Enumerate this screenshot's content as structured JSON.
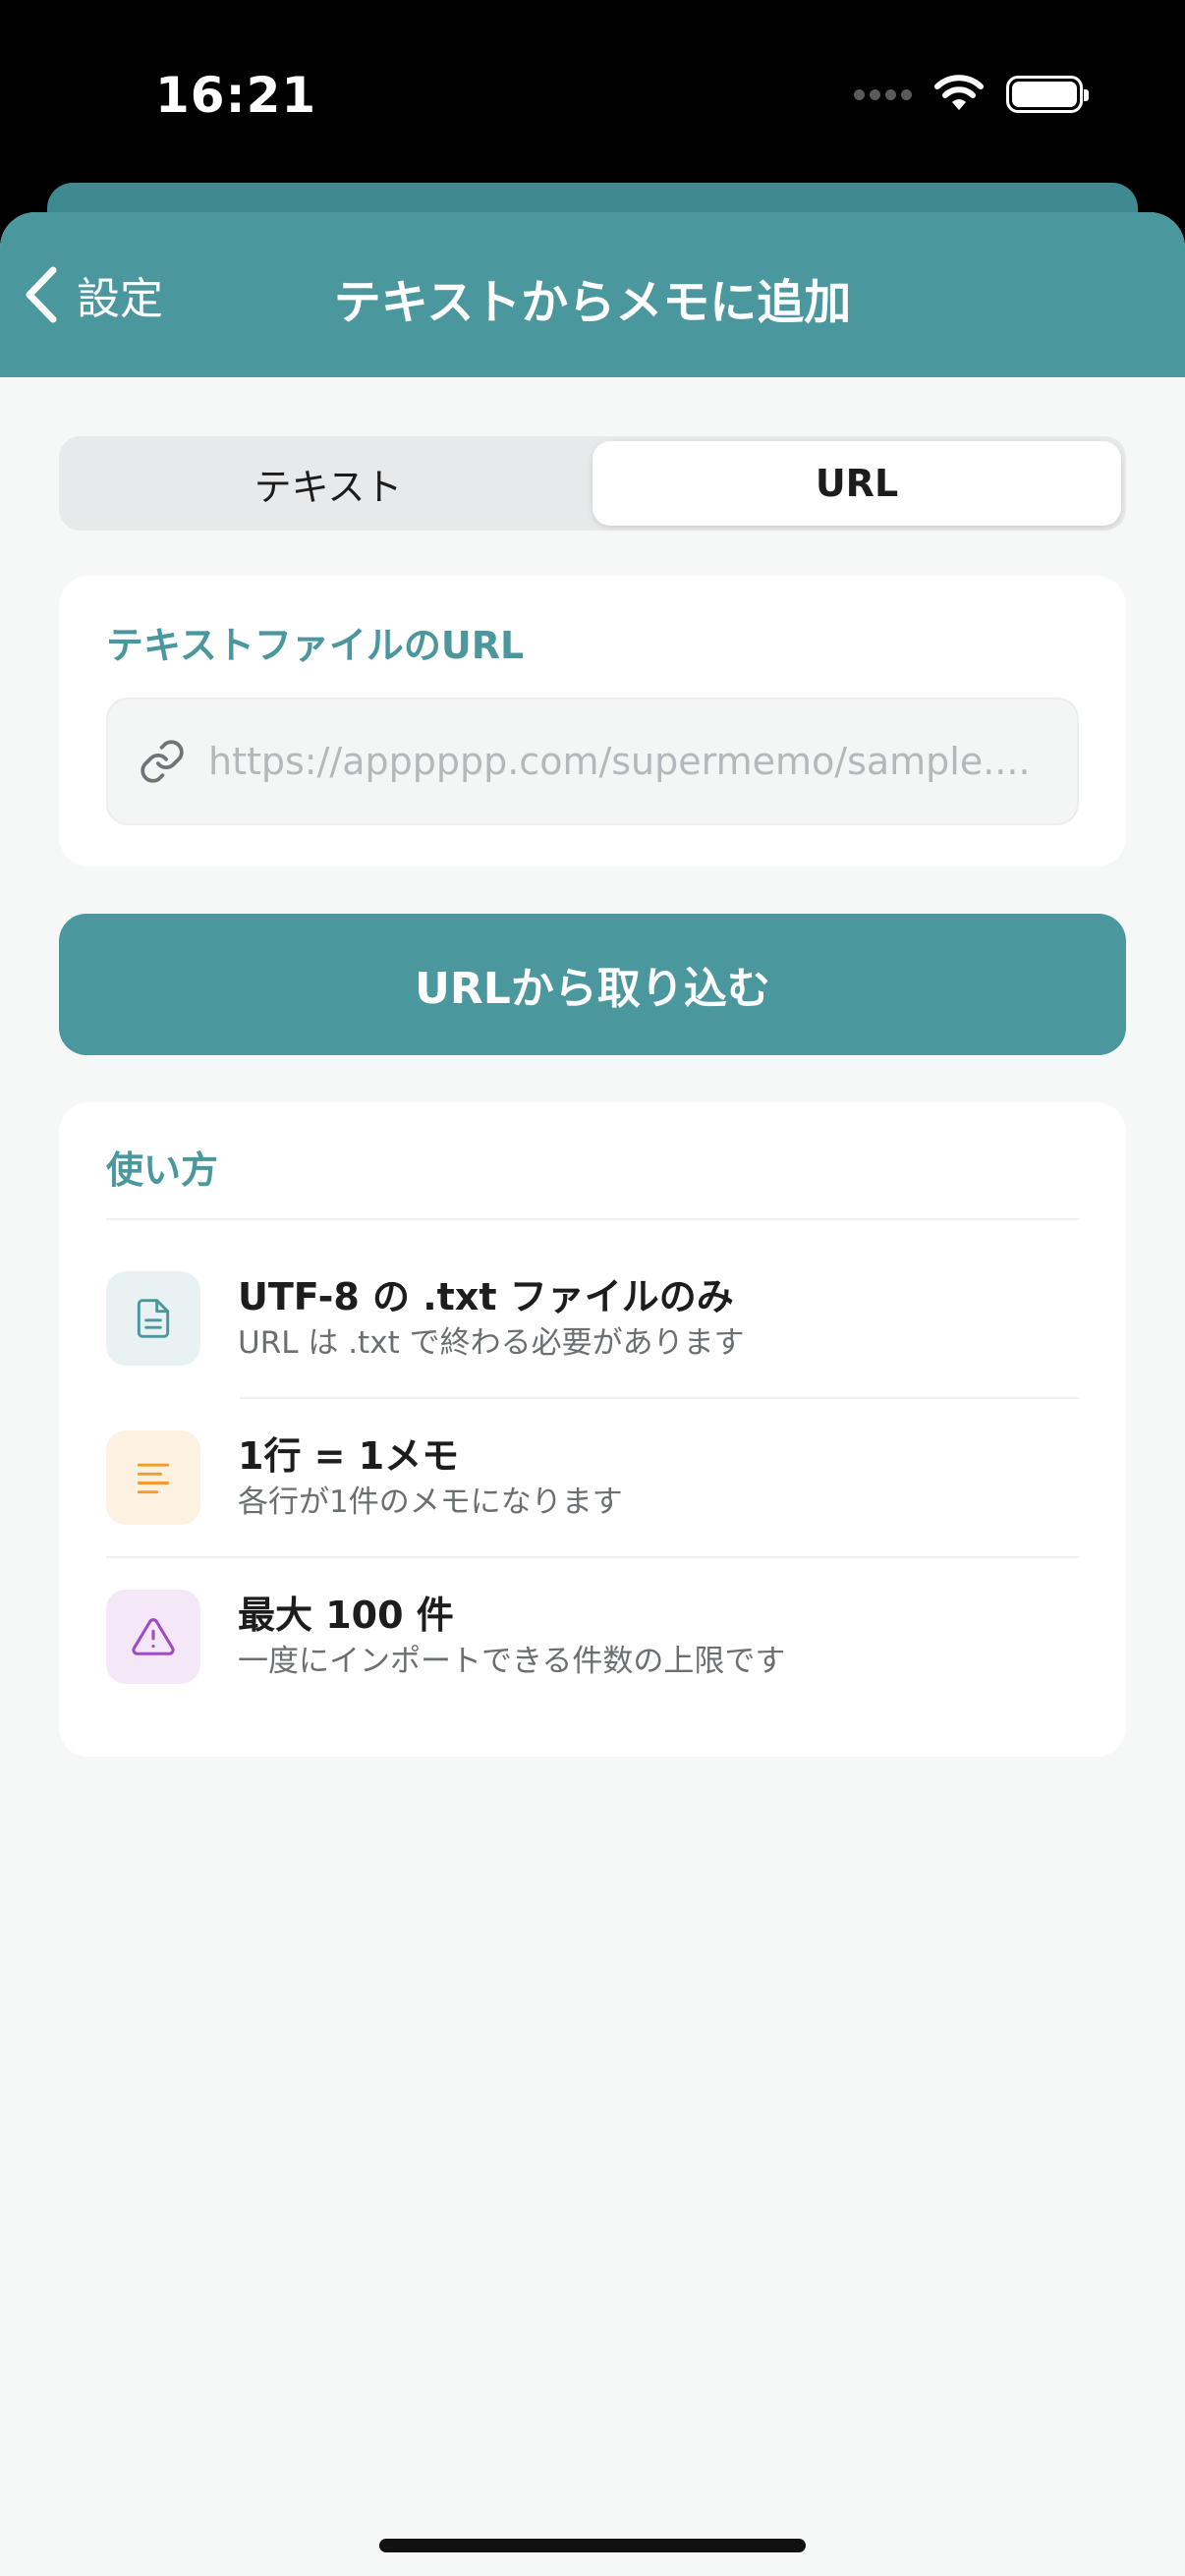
{
  "status_bar": {
    "time": "16:21"
  },
  "nav": {
    "back_label": "設定",
    "title": "テキストからメモに追加"
  },
  "segments": {
    "text_label": "テキスト",
    "url_label": "URL",
    "selected": "URL"
  },
  "url_card": {
    "label": "テキストファイルのURL",
    "placeholder": "https://apppppp.com/supermemo/sample....",
    "value": ""
  },
  "import_button": {
    "label": "URLから取り込む"
  },
  "howto": {
    "label": "使い方",
    "tips": [
      {
        "title": "UTF-8 の .txt ファイルのみ",
        "subtitle": "URL は .txt で終わる必要があります",
        "icon": "document-icon",
        "icon_color": "#4a979e",
        "icon_bg": "#e8f2f3"
      },
      {
        "title": "1行 = 1メモ",
        "subtitle": "各行が1件のメモになります",
        "icon": "lines-icon",
        "icon_color": "#f39a2b",
        "icon_bg": "#fdf1e2"
      },
      {
        "title": "最大 100 件",
        "subtitle": "一度にインポートできる件数の上限です",
        "icon": "warning-icon",
        "icon_color": "#a04bc4",
        "icon_bg": "#f4e8f8"
      }
    ]
  },
  "colors": {
    "accent": "#4a979e",
    "background": "#f6f7f7"
  }
}
